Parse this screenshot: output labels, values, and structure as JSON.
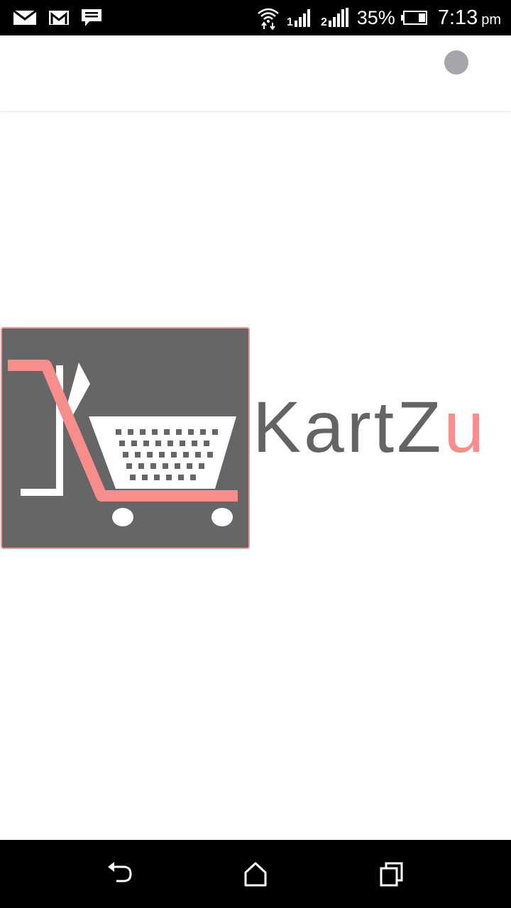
{
  "status_bar": {
    "battery_percent": "35%",
    "time": "7:13",
    "time_suffix": "pm",
    "icons": [
      "mail-icon",
      "gmail-icon",
      "message-icon",
      "wifi-icon",
      "sim1-signal-icon",
      "sim2-signal-icon",
      "battery-icon"
    ]
  },
  "app_bar": {
    "avatar_color": "#a5a5ab"
  },
  "logo": {
    "brand_part1": "KartZ",
    "brand_part2": "u",
    "brand_text_color": "#646464",
    "brand_accent_color": "#f78e8c",
    "box_color": "#666666"
  },
  "nav_bar": {
    "icons": [
      "back-icon",
      "home-icon",
      "recent-apps-icon"
    ]
  }
}
